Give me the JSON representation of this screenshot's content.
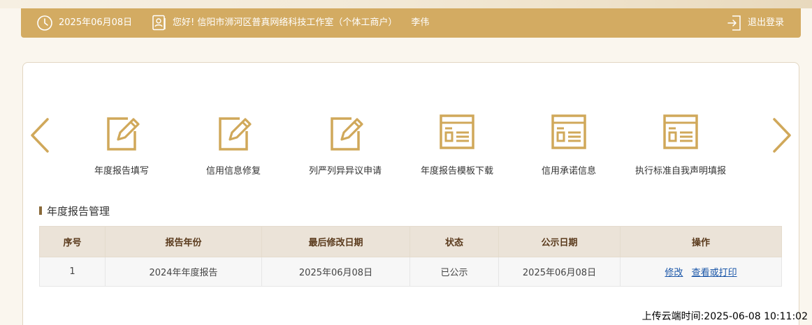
{
  "header": {
    "date": "2025年06月08日",
    "greeting": "您好!  信阳市浉河区普真网络科技工作室（个体工商户）",
    "user_name": "李伟",
    "logout_label": "退出登录"
  },
  "menu": {
    "items": [
      {
        "label": "年度报告填写",
        "icon": "edit-form-icon"
      },
      {
        "label": "信用信息修复",
        "icon": "edit-form-icon"
      },
      {
        "label": "列严列异异议申请",
        "icon": "edit-form-icon"
      },
      {
        "label": "年度报告模板下载",
        "icon": "document-window-icon"
      },
      {
        "label": "信用承诺信息",
        "icon": "document-window-icon"
      },
      {
        "label": "执行标准自我声明填报",
        "icon": "document-window-icon"
      }
    ]
  },
  "section": {
    "title": "年度报告管理"
  },
  "table": {
    "headers": [
      "序号",
      "报告年份",
      "最后修改日期",
      "状态",
      "公示日期",
      "操作"
    ],
    "rows": [
      {
        "index": "1",
        "year": "2024年年度报告",
        "modified": "2025年06月08日",
        "status": "已公示",
        "published": "2025年06月08日",
        "action_edit": "修改",
        "action_view": "查看或打印"
      }
    ]
  },
  "footer": {
    "upload_time": "上传云端时间:2025-06-08 10:11:02"
  },
  "colors": {
    "accent": "#d3ab62",
    "icon": "#d0a85a",
    "link": "#1a56a8"
  }
}
